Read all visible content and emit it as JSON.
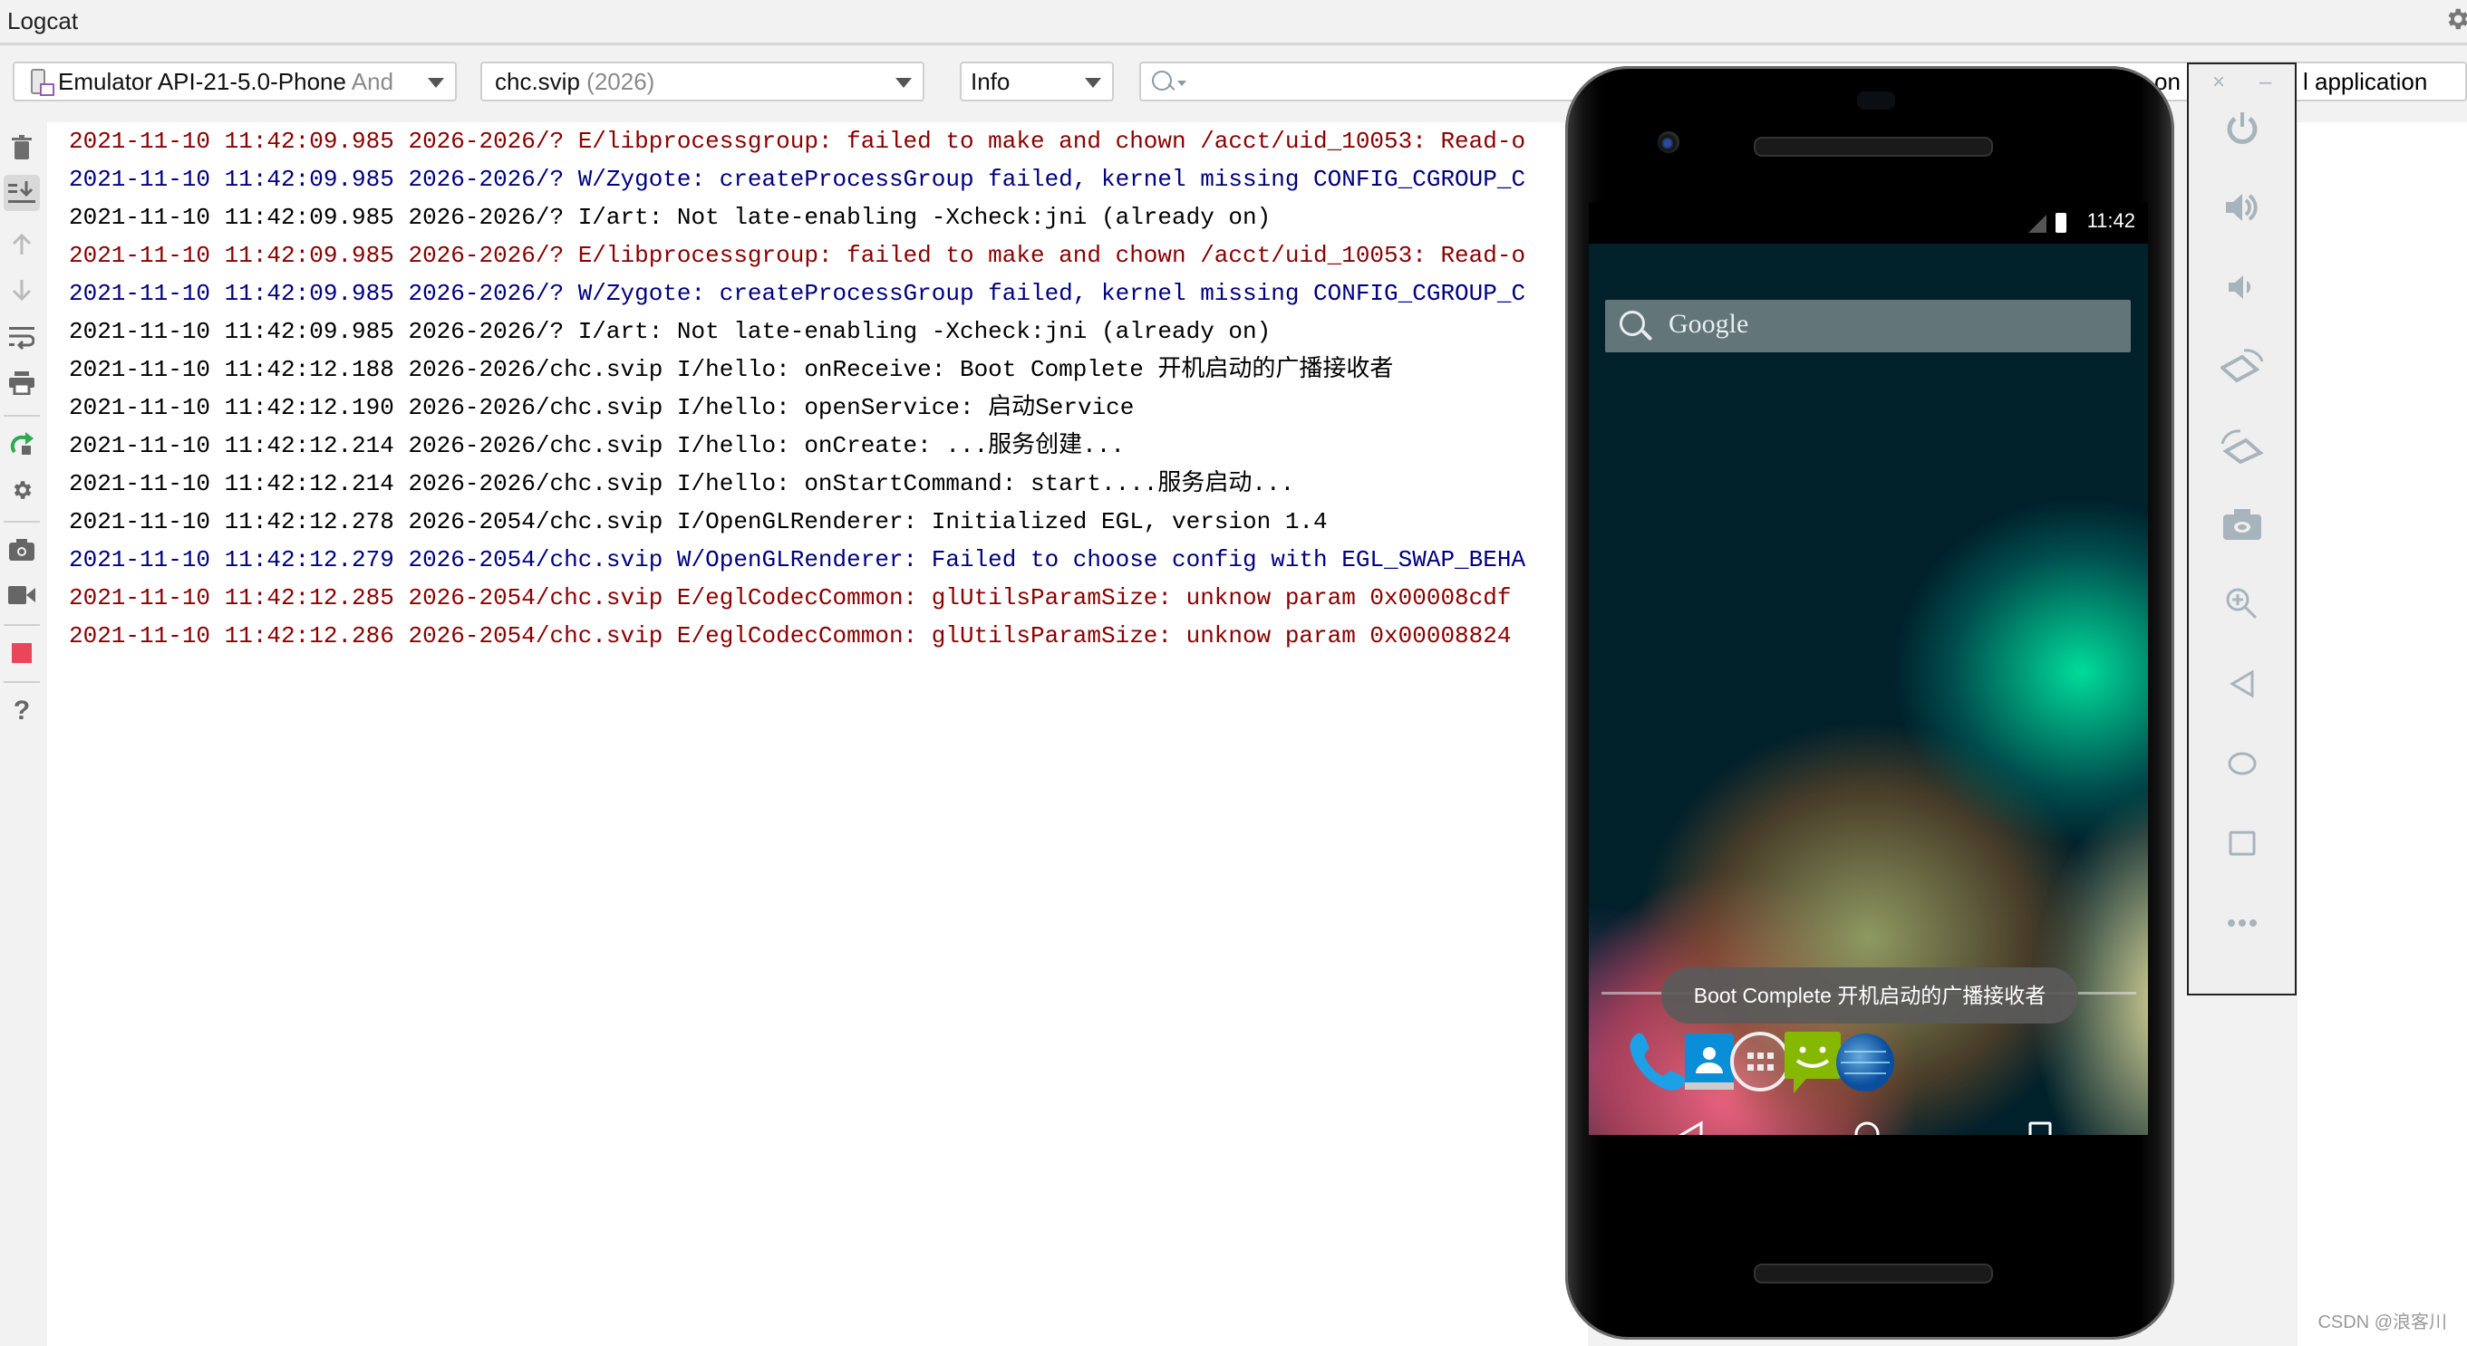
{
  "window": {
    "title": "Logcat"
  },
  "toolbar": {
    "device": {
      "name": "Emulator API-21-5.0-Phone",
      "suffix": "And"
    },
    "process": {
      "name": "chc.svip",
      "pid": "(2026)"
    },
    "level": "Info",
    "search": {
      "value": "",
      "placeholder": ""
    },
    "hidden_text_1": "on",
    "hidden_text_2": "l application"
  },
  "sidebar": {
    "icons": [
      "trash-icon",
      "scroll-to-end-icon",
      "arrow-up-icon",
      "arrow-down-icon",
      "soft-wrap-icon",
      "print-icon",
      "restart-icon",
      "settings-icon",
      "screenshot-icon",
      "screen-record-icon",
      "stop-icon",
      "help-icon"
    ]
  },
  "log": [
    {
      "level": "E",
      "text": "2021-11-10 11:42:09.985 2026-2026/? E/libprocessgroup: failed to make and chown /acct/uid_10053: Read-o"
    },
    {
      "level": "W",
      "text": "2021-11-10 11:42:09.985 2026-2026/? W/Zygote: createProcessGroup failed, kernel missing CONFIG_CGROUP_C"
    },
    {
      "level": "I",
      "text": "2021-11-10 11:42:09.985 2026-2026/? I/art: Not late-enabling -Xcheck:jni (already on)"
    },
    {
      "level": "E",
      "text": "2021-11-10 11:42:09.985 2026-2026/? E/libprocessgroup: failed to make and chown /acct/uid_10053: Read-o"
    },
    {
      "level": "W",
      "text": "2021-11-10 11:42:09.985 2026-2026/? W/Zygote: createProcessGroup failed, kernel missing CONFIG_CGROUP_C"
    },
    {
      "level": "I",
      "text": "2021-11-10 11:42:09.985 2026-2026/? I/art: Not late-enabling -Xcheck:jni (already on)"
    },
    {
      "level": "I",
      "text": "2021-11-10 11:42:12.188 2026-2026/chc.svip I/hello: onReceive: Boot Complete 开机启动的广播接收者"
    },
    {
      "level": "I",
      "text": "2021-11-10 11:42:12.190 2026-2026/chc.svip I/hello: openService: 启动Service"
    },
    {
      "level": "I",
      "text": "2021-11-10 11:42:12.214 2026-2026/chc.svip I/hello: onCreate: ...服务创建..."
    },
    {
      "level": "I",
      "text": "2021-11-10 11:42:12.214 2026-2026/chc.svip I/hello: onStartCommand: start....服务启动..."
    },
    {
      "level": "I",
      "text": "2021-11-10 11:42:12.278 2026-2054/chc.svip I/OpenGLRenderer: Initialized EGL, version 1.4"
    },
    {
      "level": "W",
      "text": "2021-11-10 11:42:12.279 2026-2054/chc.svip W/OpenGLRenderer: Failed to choose config with EGL_SWAP_BEHA"
    },
    {
      "level": "E",
      "text": "2021-11-10 11:42:12.285 2026-2054/chc.svip E/eglCodecCommon: glUtilsParamSize: unknow param 0x00008cdf"
    },
    {
      "level": "E",
      "text": "2021-11-10 11:42:12.286 2026-2054/chc.svip E/eglCodecCommon: glUtilsParamSize: unknow param 0x00008824"
    }
  ],
  "colors": {
    "error": "#8b0000",
    "warn": "#000080",
    "info": "#000000",
    "accent_green": "#2eaa4f",
    "stop_red": "#e8475a"
  },
  "emulator": {
    "status_time": "11:42",
    "search_label": "Google",
    "toast": "Boot Complete 开机启动的广播接收者",
    "dock_apps": [
      "phone",
      "contacts",
      "all-apps",
      "messaging",
      "browser"
    ],
    "nav": [
      "back",
      "home",
      "recents"
    ]
  },
  "emulator_controls": {
    "window_buttons": {
      "close": "×",
      "minimize": "–"
    },
    "buttons": [
      "power",
      "volume-up",
      "volume-down",
      "rotate-left",
      "rotate-right",
      "screenshot",
      "zoom",
      "back",
      "home",
      "overview",
      "more"
    ]
  },
  "watermark": "CSDN @浪客川"
}
